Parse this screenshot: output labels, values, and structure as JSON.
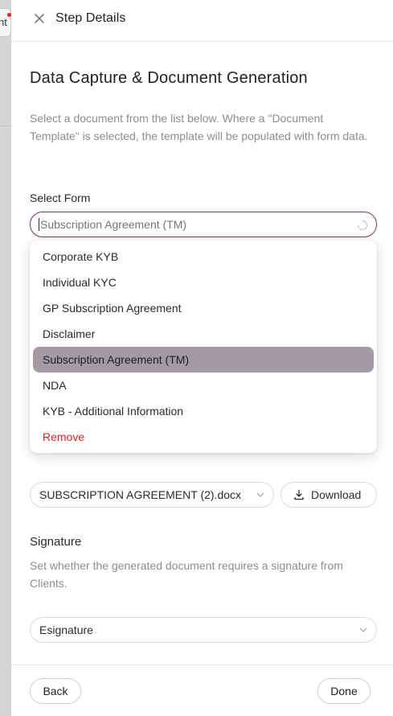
{
  "background": {
    "button_fragment": "nt"
  },
  "header": {
    "title": "Step Details",
    "close_icon": "close-icon"
  },
  "main": {
    "title": "Data Capture & Document Generation",
    "description": "Select a document from the list below. Where a \"Document Template\" is selected, the template will be populated with form data.",
    "select_form": {
      "label": "Select Form",
      "placeholder": "Subscription Agreement (TM)",
      "value": ""
    },
    "dropdown": {
      "options": [
        {
          "label": "Corporate KYB"
        },
        {
          "label": "Individual KYC"
        },
        {
          "label": "GP Subscription Agreement"
        },
        {
          "label": "Disclaimer"
        },
        {
          "label": "Subscription Agreement (TM)"
        },
        {
          "label": "NDA"
        },
        {
          "label": "KYB - Additional Information"
        },
        {
          "label": "Remove"
        }
      ],
      "selected_index": 4
    },
    "template": {
      "file": "SUBSCRIPTION AGREEMENT (2).docx",
      "download_label": "Download"
    },
    "signature": {
      "title": "Signature",
      "description": "Set whether the generated document requires a signature from Clients.",
      "value": "Esignature"
    }
  },
  "footer": {
    "back_label": "Back",
    "done_label": "Done"
  },
  "colors": {
    "focus_border": "#7a3a73",
    "selected_option": "#a49aa1",
    "danger": "#d9232b"
  }
}
